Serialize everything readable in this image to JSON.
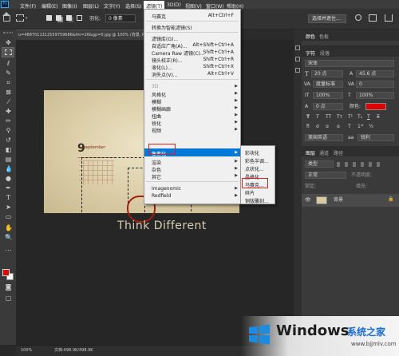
{
  "menubar": {
    "app_logo": "Ps",
    "items": [
      "文件(F)",
      "编辑(E)",
      "图像(I)",
      "图层(L)",
      "文字(Y)",
      "选择(S)",
      "滤镜(T)",
      "3D(D)",
      "视图(V)",
      "窗口(W)",
      "帮助(H)"
    ]
  },
  "options_bar": {
    "feather_label": "羽化:",
    "feather_value": "0 像素",
    "select_mask_button": "选择并遮住..."
  },
  "document_tab": {
    "title": "u=4887011312559759686&fm=26&gp=0.jpg @ 100% (背景, RGB/8)"
  },
  "canvas_image": {
    "day_number": "9",
    "month_label": "september",
    "tagline": "Think Different"
  },
  "status_bar": {
    "zoom": "100%",
    "doc_size": "文档:498.9K/498.9K"
  },
  "filter_menu": {
    "items": [
      {
        "label": "马赛克",
        "shortcut": "Alt+Ctrl+F"
      },
      {
        "label": "转换为智能滤镜(S)",
        "shortcut": ""
      },
      {
        "label": "滤镜库(G)...",
        "shortcut": ""
      },
      {
        "label": "自适应广角(A)...",
        "shortcut": "Alt+Shift+Ctrl+A"
      },
      {
        "label": "Camera Raw 滤镜(C)...",
        "shortcut": "Shift+Ctrl+A"
      },
      {
        "label": "镜头校正(R)...",
        "shortcut": "Shift+Ctrl+R"
      },
      {
        "label": "液化(L)...",
        "shortcut": "Shift+Ctrl+X"
      },
      {
        "label": "消失点(V)...",
        "shortcut": "Alt+Ctrl+V"
      },
      {
        "label": "3D",
        "shortcut": ""
      },
      {
        "label": "风格化",
        "shortcut": ""
      },
      {
        "label": "模糊",
        "shortcut": ""
      },
      {
        "label": "模糊画廊",
        "shortcut": ""
      },
      {
        "label": "扭曲",
        "shortcut": ""
      },
      {
        "label": "锐化",
        "shortcut": ""
      },
      {
        "label": "视频",
        "shortcut": ""
      },
      {
        "label": "像素化",
        "shortcut": ""
      },
      {
        "label": "渲染",
        "shortcut": ""
      },
      {
        "label": "杂色",
        "shortcut": ""
      },
      {
        "label": "其它",
        "shortcut": ""
      },
      {
        "label": "Imagenomic",
        "shortcut": ""
      },
      {
        "label": "Redfield",
        "shortcut": ""
      }
    ]
  },
  "pixelate_submenu": {
    "items": [
      "彩块化",
      "彩色半调...",
      "点状化...",
      "晶格化...",
      "马赛克...",
      "碎片",
      "铜版雕刻..."
    ]
  },
  "right_panel": {
    "tabs_top": [
      "颜色",
      "色板"
    ],
    "tabs_char": [
      "字符",
      "段落"
    ],
    "font_family": "宋体",
    "font_size": "20 点",
    "leading": "45.6 点",
    "tracking_label": "度量标准",
    "tracking_value": "0",
    "scale_v": "100%",
    "scale_h": "100%",
    "baseline": "0 点",
    "color_label": "颜色:",
    "lang": "美国英语",
    "aa_label": "aa",
    "aa_value": "锐利",
    "layers_tabs": [
      "图层",
      "通道",
      "路径"
    ],
    "layer_kind": "类型",
    "blend_mode": "正常",
    "opacity_label": "不透明度:",
    "fill_label": "填充:",
    "lock_label": "锁定:",
    "layer_name": "背景"
  },
  "watermark": {
    "brand": "Windows",
    "cn": "系统之家",
    "url": "www.bjjmlv.com"
  },
  "colors": {
    "accent_blue": "#0078d7",
    "highlight_red": "#e02020",
    "foreground_swatch": "#e00000",
    "background_swatch": "#ffffff"
  }
}
